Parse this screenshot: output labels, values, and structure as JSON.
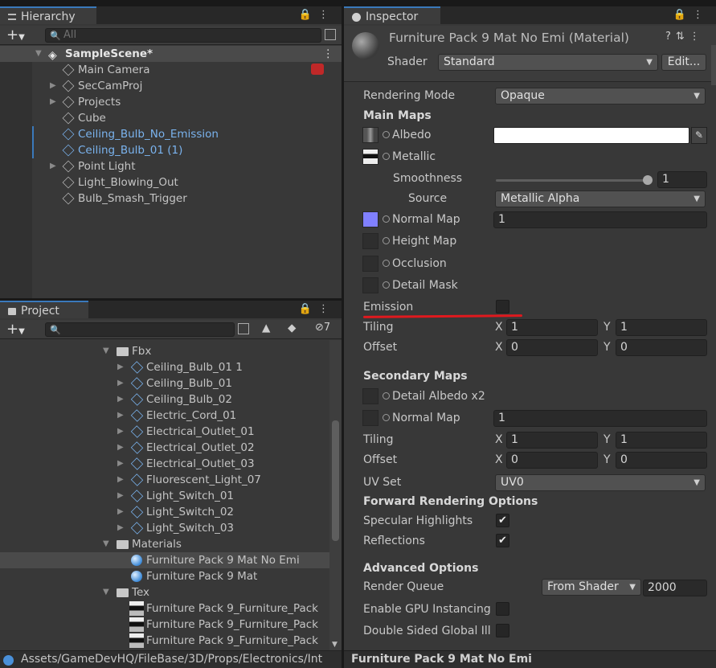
{
  "hierarchy": {
    "tab_label": "Hierarchy",
    "search_placeholder": "All",
    "scene_name": "SampleScene*",
    "items": [
      {
        "label": "Main Camera",
        "highlight": false,
        "expandable": false
      },
      {
        "label": "SecCamProj",
        "highlight": false,
        "expandable": true
      },
      {
        "label": "Projects",
        "highlight": false,
        "expandable": true
      },
      {
        "label": "Cube",
        "highlight": false,
        "expandable": false
      },
      {
        "label": "Ceiling_Bulb_No_Emission",
        "highlight": true,
        "expandable": false
      },
      {
        "label": "Ceiling_Bulb_01 (1)",
        "highlight": true,
        "expandable": false
      },
      {
        "label": "Point Light",
        "highlight": false,
        "expandable": true
      },
      {
        "label": "Light_Blowing_Out",
        "highlight": false,
        "expandable": false
      },
      {
        "label": "Bulb_Smash_Trigger",
        "highlight": false,
        "expandable": false
      }
    ]
  },
  "project": {
    "tab_label": "Project",
    "hidden_count": "7",
    "folder_fbx": "Fbx",
    "fbx_items": [
      "Ceiling_Bulb_01 1",
      "Ceiling_Bulb_01",
      "Ceiling_Bulb_02",
      "Electric_Cord_01",
      "Electrical_Outlet_01",
      "Electrical_Outlet_02",
      "Electrical_Outlet_03",
      "Fluorescent_Light_07",
      "Light_Switch_01",
      "Light_Switch_02",
      "Light_Switch_03"
    ],
    "folder_materials": "Materials",
    "material_items": [
      "Furniture Pack 9 Mat No Emi",
      "Furniture Pack 9 Mat"
    ],
    "folder_tex": "Tex",
    "tex_items": [
      "Furniture Pack 9_Furniture_Pack",
      "Furniture Pack 9_Furniture_Pack",
      "Furniture Pack 9_Furniture_Pack"
    ],
    "path": "Assets/GameDevHQ/FileBase/3D/Props/Electronics/Int"
  },
  "inspector": {
    "tab_label": "Inspector",
    "title": "Furniture Pack 9 Mat No Emi (Material)",
    "shader_label": "Shader",
    "shader_value": "Standard",
    "edit_button": "Edit...",
    "rendering_mode_label": "Rendering Mode",
    "rendering_mode_value": "Opaque",
    "main_maps": "Main Maps",
    "albedo": "Albedo",
    "metallic": "Metallic",
    "smoothness": "Smoothness",
    "smoothness_value": "1",
    "source": "Source",
    "source_value": "Metallic Alpha",
    "normal_map": "Normal Map",
    "normal_map_value": "1",
    "height_map": "Height Map",
    "occlusion": "Occlusion",
    "detail_mask": "Detail Mask",
    "emission": "Emission",
    "tiling": "Tiling",
    "offset": "Offset",
    "x": "X",
    "y": "Y",
    "tiling_x": "1",
    "tiling_y": "1",
    "offset_x": "0",
    "offset_y": "0",
    "secondary_maps": "Secondary Maps",
    "detail_albedo": "Detail Albedo x2",
    "sec_normal_map": "Normal Map",
    "sec_normal_value": "1",
    "sec_tiling_x": "1",
    "sec_tiling_y": "1",
    "sec_offset_x": "0",
    "sec_offset_y": "0",
    "uv_set": "UV Set",
    "uv_set_value": "UV0",
    "forward_opts": "Forward Rendering Options",
    "specular": "Specular Highlights",
    "reflections": "Reflections",
    "advanced": "Advanced Options",
    "render_queue": "Render Queue",
    "render_queue_mode": "From Shader",
    "render_queue_value": "2000",
    "gpu_instancing": "Enable GPU Instancing",
    "double_sided": "Double Sided Global Ill",
    "footer": "Furniture Pack 9 Mat No Emi"
  },
  "colors": {
    "accent": "#3a79bb",
    "highlight_text": "#7ab3ee",
    "annotation": "#e0191e",
    "normal_map": "#8080ff"
  }
}
